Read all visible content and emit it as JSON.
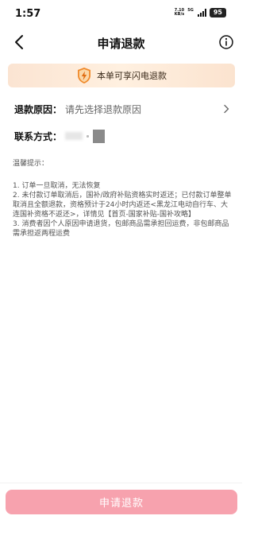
{
  "status_bar": {
    "time": "1:57",
    "net_speed_value": "7.10",
    "net_speed_unit": "KB/s",
    "network": "5G",
    "battery": "95"
  },
  "nav": {
    "title": "申请退款",
    "back_icon": "chevron-left-icon",
    "info_icon": "info-circle-icon"
  },
  "banner": {
    "icon": "lightning-shield-icon",
    "text": "本单可享闪电退款",
    "accent_color": "#e8782a"
  },
  "form": {
    "reason_label": "退款原因：",
    "reason_placeholder": "请先选择退款原因",
    "contact_label": "联系方式："
  },
  "tips": {
    "title": "温馨提示：",
    "items": [
      "1. 订单一旦取消，无法恢复",
      "2. 未付款订单取消后，国补/政府补贴资格实时返还；已付款订单整单取消且全额退款，资格预计于24小时内返还<黑龙江电动自行车、大连国补资格不返还>，详情见【首页-国家补贴-国补攻略】",
      "3. 消费者因个人原因申请退货，包邮商品需承担回运费，非包邮商品需承担返两程运费"
    ]
  },
  "footer": {
    "submit_label": "申请退款",
    "button_color": "#f7a2ae"
  }
}
